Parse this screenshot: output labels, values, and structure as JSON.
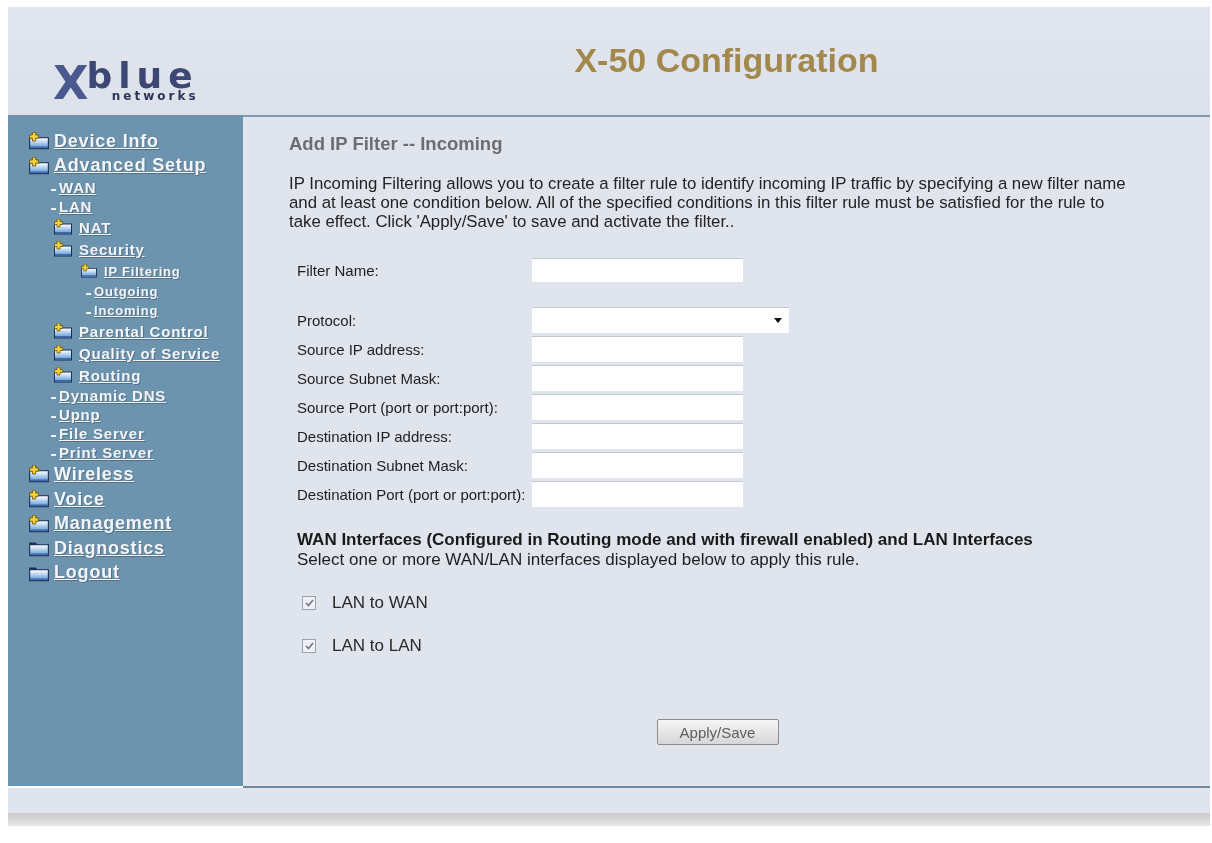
{
  "header": {
    "logo": {
      "mark": "X",
      "name": "blue",
      "tagline": "networks"
    },
    "title": "X-50 Configuration"
  },
  "sidebar": {
    "items": [
      {
        "label": "Device Info",
        "kind": "folder"
      },
      {
        "label": "Advanced Setup",
        "kind": "folder",
        "children": [
          {
            "label": "WAN",
            "kind": "leaf"
          },
          {
            "label": "LAN",
            "kind": "leaf"
          },
          {
            "label": "NAT",
            "kind": "folder"
          },
          {
            "label": "Security",
            "kind": "folder",
            "children": [
              {
                "label": "IP Filtering",
                "kind": "folder",
                "children": [
                  {
                    "label": "Outgoing",
                    "kind": "leaf"
                  },
                  {
                    "label": "Incoming",
                    "kind": "leaf"
                  }
                ]
              }
            ]
          },
          {
            "label": "Parental Control",
            "kind": "folder"
          },
          {
            "label": "Quality of Service",
            "kind": "folder"
          },
          {
            "label": "Routing",
            "kind": "folder"
          },
          {
            "label": "Dynamic DNS",
            "kind": "leaf"
          },
          {
            "label": "Upnp",
            "kind": "leaf"
          },
          {
            "label": "File Server",
            "kind": "leaf"
          },
          {
            "label": "Print Server",
            "kind": "leaf"
          }
        ]
      },
      {
        "label": "Wireless",
        "kind": "folder"
      },
      {
        "label": "Voice",
        "kind": "folder"
      },
      {
        "label": "Management",
        "kind": "folder"
      },
      {
        "label": "Diagnostics",
        "kind": "page"
      },
      {
        "label": "Logout",
        "kind": "page"
      }
    ]
  },
  "page": {
    "title": "Add IP Filter -- Incoming",
    "description": "IP Incoming Filtering allows you to create a filter rule to identify incoming IP traffic by specifying a new filter name and at least one condition below. All of the specified conditions in this filter rule must be satisfied for the rule to take effect. Click 'Apply/Save' to save and activate the filter.."
  },
  "form": {
    "filter_name": {
      "label": "Filter Name:"
    },
    "conditions": [
      {
        "label": "Protocol:",
        "kind": "select"
      },
      {
        "label": "Source IP address:",
        "kind": "text"
      },
      {
        "label": "Source Subnet Mask:",
        "kind": "text"
      },
      {
        "label": "Source Port (port or port:port):",
        "kind": "text"
      },
      {
        "label": "Destination IP address:",
        "kind": "text"
      },
      {
        "label": "Destination Subnet Mask:",
        "kind": "text"
      },
      {
        "label": "Destination Port (port or port:port):",
        "kind": "text"
      }
    ]
  },
  "interfaces": {
    "heading": "WAN Interfaces (Configured in Routing mode and with firewall enabled) and LAN Interfaces",
    "hint": "Select one or more WAN/LAN interfaces displayed below to apply this rule.",
    "options": [
      {
        "label": "LAN to WAN",
        "checked": true
      },
      {
        "label": "LAN to LAN",
        "checked": true
      }
    ]
  },
  "apply_button": {
    "label": "Apply/Save"
  }
}
